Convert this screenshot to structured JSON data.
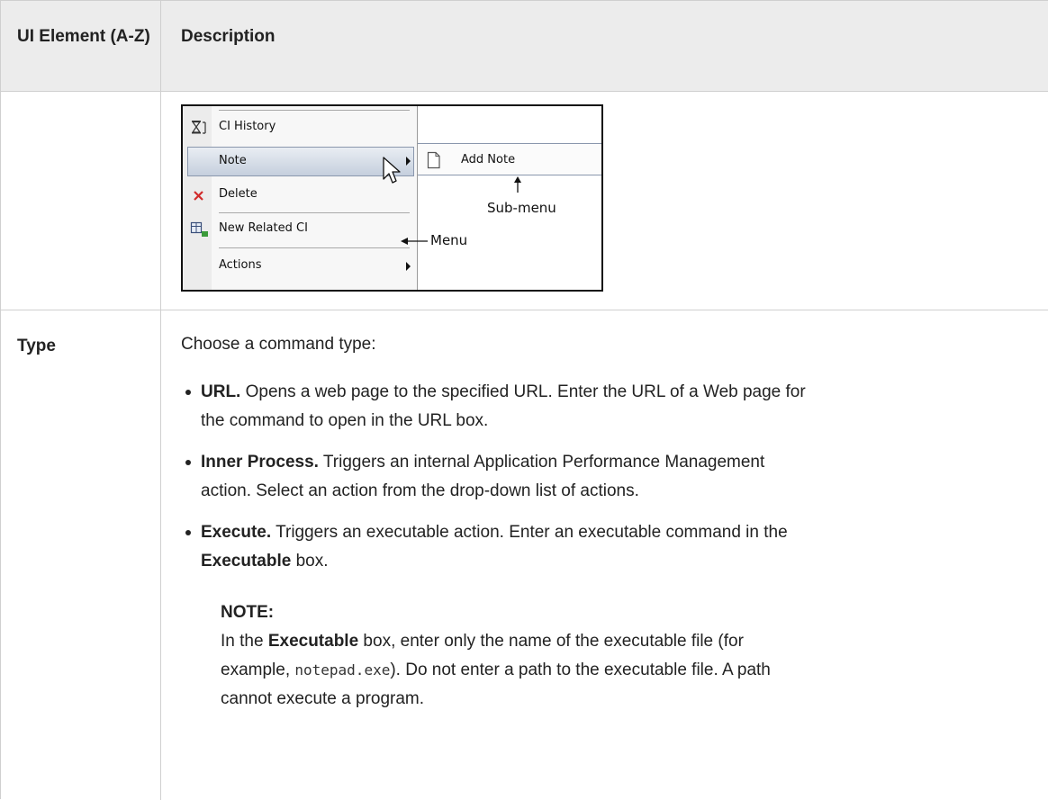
{
  "header": {
    "col1": "UI Element (A-Z)",
    "col2": "Description"
  },
  "figure": {
    "menu_items": {
      "ci_history": "CI History",
      "note": "Note",
      "delete": "Delete",
      "new_related_ci": "New Related CI",
      "actions": "Actions"
    },
    "submenu_item": "Add Note",
    "annotation_submenu": "Sub-menu",
    "annotation_menu": "Menu",
    "icons": [
      "hourglass-icon",
      "document-icon",
      "delete-x-icon",
      "new-related-ci-icon",
      "submenu-arrow-icon",
      "mouse-pointer-icon"
    ]
  },
  "row_type": {
    "label": "Type",
    "intro": "Choose a command type:",
    "bullets": [
      {
        "term": "URL.",
        "line1": " Opens a web page to the specified URL. Enter the URL of a Web page for",
        "line2": "the command to open in the URL box."
      },
      {
        "term": "Inner Process.",
        "line1": " Triggers an internal Application Performance Management",
        "line2": "action. Select an action from the drop-down list of actions."
      },
      {
        "term": "Execute.",
        "line1": " Triggers an executable action. Enter an executable command in the",
        "line2_bold": "Executable",
        "line2_rest": " box."
      }
    ],
    "note": {
      "heading": "NOTE:",
      "l1_pre": "In the ",
      "l1_bold": "Executable",
      "l1_post": " box, enter only the name of the executable file (for",
      "l2_pre": "example, ",
      "l2_code": "notepad.exe",
      "l2_post": "). Do not enter a path to the executable file. A path",
      "l3": "cannot execute a program."
    }
  }
}
